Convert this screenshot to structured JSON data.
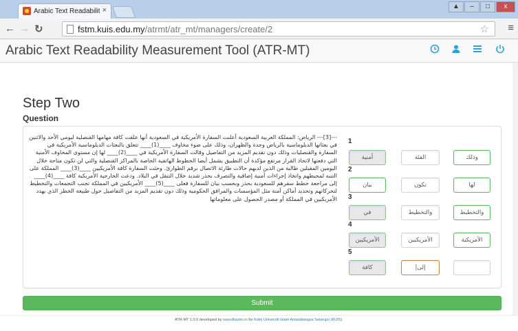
{
  "browser": {
    "tab_title": "Arabic Text Readability Meas",
    "tab_close": "×",
    "url_host": "fstm.kuis.edu.my",
    "url_path": "/atrmt/atr_mt/managers/create/2",
    "window_buttons": [
      "▲",
      "–",
      "□",
      "x"
    ]
  },
  "app": {
    "title": "Arabic Text Readability Measurement Tool (ATR-MT)",
    "nav_icons": [
      "clock-icon",
      "user-icon",
      "list-icon",
      "power-icon"
    ]
  },
  "step_title": "Step Two",
  "question_label": "Question",
  "passage": "---[3]--- الرياض: المملكة العربية السعودية أعلنت السفارة الأمريكية في السعودية أنها علقت كافة مهامها القنصلية ليومي الأحد والاثنين في بعثاتها الدبلوماسية بالرياض وجدة والظهران، وذلك على ضوء مخاوف ____(1)____ تتعلق بالبعثات الدبلوماسية الأمريكية في السفارة والقنصليات وذلك دون تقديم المزيد من التفاصيل وقالت السفارة الأمريكية في ____(2)____ لها إن مستوى المخاوف الأمنية التي دفعتها لاتخاذ القرار مرتفع مؤكدة أن التطبيق يشمل أيضا الخطوط الهاتفية الخاصة بالمراكز القنصلية والتي لن تكون متاحة خلال اليومين المقبلين طالبة من الذين لديهم حالات طارئة الاتصال برقم الطوارئ. وحثت السفارة كافة الأمريكيين ____(3)____ المملكة على التنبه لمحيطهم واتخاذ إجراءات أمنية إضافية والتصرف بحذر شديد خلال التنقل في البلاد. ودعت الخارجية الأمريكية كافة ____(4)____ إلى مراجعة خطط سفرهم للسعودية بحذر وبحسب بيان للسفارة فعلى ____(5)____ الأمريكيين في المملكة تجنب التجمعات والتخطيط لتحركاتهم وتحديد أماكن آمنة مثل المؤسسات والمرافق الحكومية وذلك دون تقديم المزيد من التفاصيل حول طبيعة الخطر الذي يهدد الأمريكيين في المملكة أو مصدر الحصول على معلوماتها",
  "questions": [
    {
      "number": "1",
      "options": [
        "وذلك",
        "الفئة",
        "أمنية"
      ]
    },
    {
      "number": "2",
      "options": [
        "لها",
        "تكون",
        "بيان"
      ]
    },
    {
      "number": "3",
      "options": [
        "والتخطيط",
        "والتخطيط",
        "في"
      ]
    },
    {
      "number": "4",
      "options": [
        "الأمريكية",
        "الأمريكيين",
        "الأمريكيين"
      ]
    },
    {
      "number": "5",
      "options": [
        "",
        "إلى|",
        "كافة"
      ]
    }
  ],
  "submit_label": "Submit",
  "footer": {
    "prefix": "ATR-MT 1.0.0 developed by ",
    "author": "nasrulhazim.m",
    "middle": " for ",
    "org": "Kolej Universiti Islam Antarabangsa Selangor (KUIS)",
    "suffix": "."
  }
}
